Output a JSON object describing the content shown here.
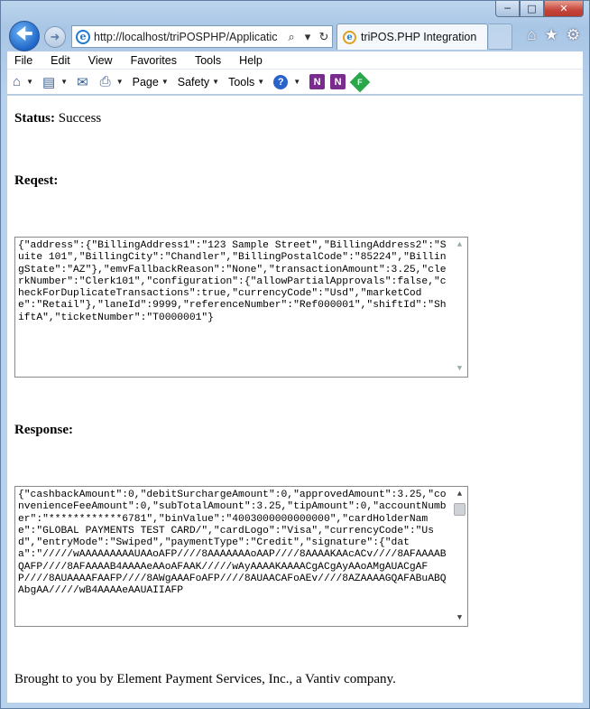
{
  "browser": {
    "address_url": "http://localhost/triPOSPHP/Applicatic",
    "tab_title": "triPOS.PHP Integration"
  },
  "menu": [
    "File",
    "Edit",
    "View",
    "Favorites",
    "Tools",
    "Help"
  ],
  "commands": {
    "page": "Page",
    "safety": "Safety",
    "tools": "Tools"
  },
  "page": {
    "status_label": "Status:",
    "status_value": "Success",
    "request_label": "Reqest:",
    "request_body": "{\"address\":{\"BillingAddress1\":\"123 Sample Street\",\"BillingAddress2\":\"Suite 101\",\"BillingCity\":\"Chandler\",\"BillingPostalCode\":\"85224\",\"BillingState\":\"AZ\"},\"emvFallbackReason\":\"None\",\"transactionAmount\":3.25,\"clerkNumber\":\"Clerk101\",\"configuration\":{\"allowPartialApprovals\":false,\"checkForDuplicateTransactions\":true,\"currencyCode\":\"Usd\",\"marketCode\":\"Retail\"},\"laneId\":9999,\"referenceNumber\":\"Ref000001\",\"shiftId\":\"ShiftA\",\"ticketNumber\":\"T0000001\"}",
    "response_label": "Response:",
    "response_body": "{\"cashbackAmount\":0,\"debitSurchargeAmount\":0,\"approvedAmount\":3.25,\"convenienceFeeAmount\":0,\"subTotalAmount\":3.25,\"tipAmount\":0,\"accountNumber\":\"************6781\",\"binValue\":\"4003000000000000\",\"cardHolderName\":\"GLOBAL PAYMENTS TEST CARD/\",\"cardLogo\":\"Visa\",\"currencyCode\":\"Usd\",\"entryMode\":\"Swiped\",\"paymentType\":\"Credit\",\"signature\":{\"data\":\"/////wAAAAAAAAAUAAoAFP////8AAAAAAAoAAP////8AAAAKAAcACv////8AFAAAABQAFP////8AFAAAAB4AAAAeAAoAFAAK/////wAyAAAAKAAAACgACgAyAAoAMgAUACgAFP////8AUAAAAFAAFP////8AWgAAAFoAFP////8AUAACAFoAEv////8AZAAAAGQAFABuABQAbgAA/////wB4AAAAeAAUAIIAFP",
    "footer": "Brought to you by Element Payment Services, Inc., a Vantiv company."
  }
}
